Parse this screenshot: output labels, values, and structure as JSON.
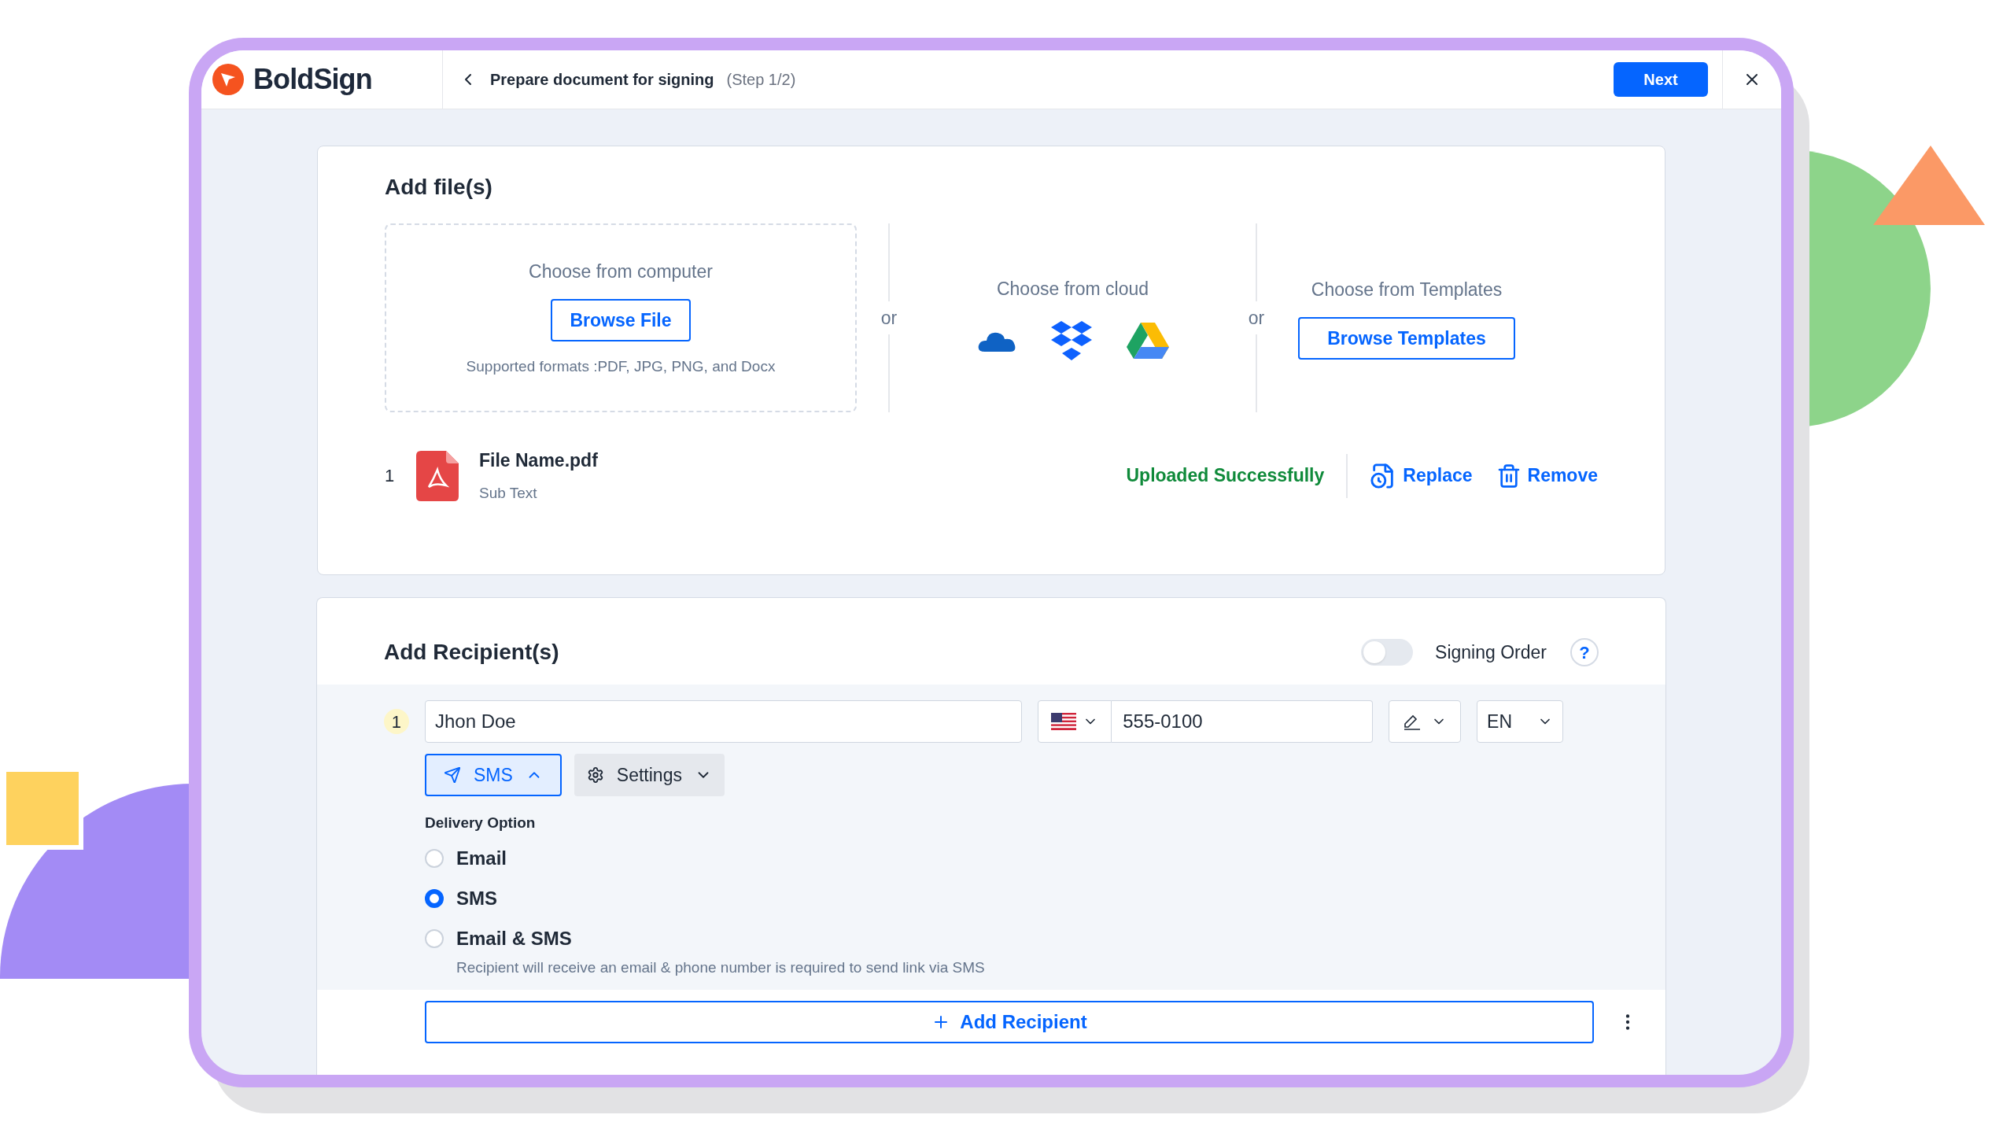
{
  "header": {
    "logo": "BoldSign",
    "title": "Prepare document for signing",
    "step": "(Step 1/2)",
    "next": "Next"
  },
  "files": {
    "title": "Add file(s)",
    "computer": {
      "label": "Choose from computer",
      "button": "Browse File",
      "formats": "Supported formats :PDF, JPG, PNG, and Docx"
    },
    "separators": [
      "or",
      "or"
    ],
    "cloud": {
      "label": "Choose from cloud"
    },
    "templates": {
      "label": "Choose from Templates",
      "button": "Browse Templates"
    },
    "file": {
      "index": "1",
      "name": "File Name.pdf",
      "subtext": "Sub Text",
      "status": "Uploaded Successfully",
      "replace": "Replace",
      "remove": "Remove"
    }
  },
  "recipients": {
    "title": "Add Recipient(s)",
    "signing_order": {
      "label": "Signing Order",
      "on": false
    },
    "help": "?",
    "recipient": {
      "index": "1",
      "name": "Jhon Doe",
      "phone": "555-0100",
      "language": "EN",
      "delivery_button": "SMS",
      "expanded": true,
      "settings": "Settings",
      "delivery_title": "Delivery Option",
      "options": [
        {
          "label": "Email",
          "selected": false
        },
        {
          "label": "SMS",
          "selected": true
        },
        {
          "label": "Email & SMS",
          "selected": false
        }
      ],
      "note": "Recipient will receive an email & phone number is required to send link via SMS"
    },
    "add": "Add Recipient"
  }
}
